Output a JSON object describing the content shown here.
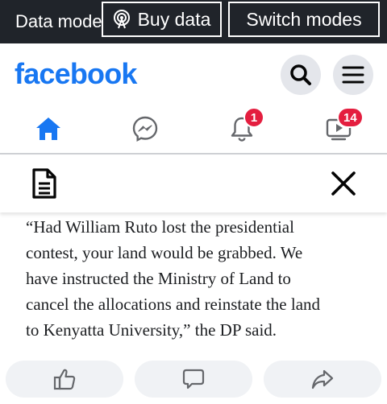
{
  "data_mode_bar": {
    "mode_text": "Data mode",
    "buy_data_label": "Buy data",
    "switch_modes_label": "Switch modes"
  },
  "header": {
    "logo_text": "facebook",
    "icons": [
      "search-icon",
      "menu-icon"
    ]
  },
  "nav": {
    "tabs": [
      {
        "name": "home",
        "icon": "home-icon",
        "active": true
      },
      {
        "name": "messenger",
        "icon": "messenger-icon"
      },
      {
        "name": "notifications",
        "icon": "bell-icon",
        "badge": "1"
      },
      {
        "name": "watch",
        "icon": "video-icon",
        "badge": "14"
      }
    ]
  },
  "article": {
    "lines": [
      "“Had William Ruto lost the presidential",
      "contest, your land would be grabbed. We",
      "have instructed the Ministry of Land to",
      "cancel the allocations and reinstate the land",
      "to Kenyatta University,” the DP said."
    ]
  },
  "reactions": {
    "icons": [
      "like-icon",
      "comment-icon",
      "share-icon"
    ]
  },
  "colors": {
    "brand": "#1877f2",
    "badge": "#e41e3f",
    "data_bar": "#20242a"
  }
}
